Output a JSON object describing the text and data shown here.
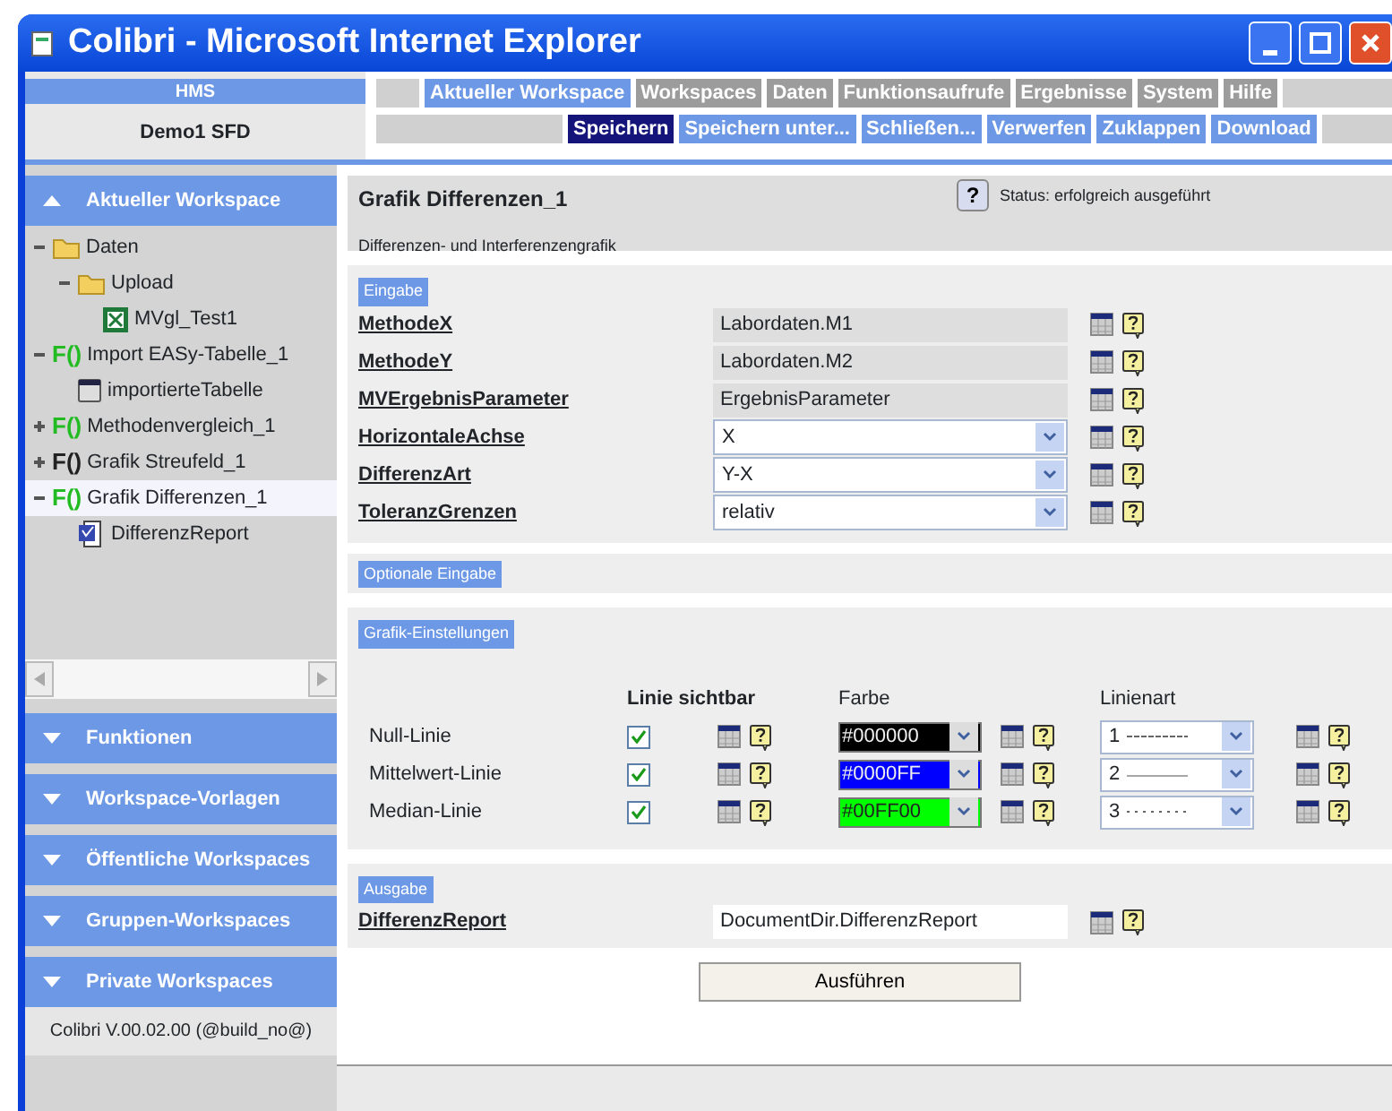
{
  "window": {
    "title": "Colibri - Microsoft Internet Explorer"
  },
  "header": {
    "app": "HMS",
    "workspace": "Demo1 SFD"
  },
  "menu": [
    {
      "label": "Aktueller Workspace",
      "selected": true
    },
    {
      "label": "Workspaces",
      "selected": false
    },
    {
      "label": "Daten",
      "selected": false
    },
    {
      "label": "Funktionsaufrufe",
      "selected": false
    },
    {
      "label": "Ergebnisse",
      "selected": false
    },
    {
      "label": "System",
      "selected": false
    },
    {
      "label": "Hilfe",
      "selected": false
    }
  ],
  "toolbar": [
    {
      "label": "Speichern",
      "selected": true
    },
    {
      "label": "Speichern unter...",
      "selected": false
    },
    {
      "label": "Schließen...",
      "selected": false
    },
    {
      "label": "Verwerfen",
      "selected": false
    },
    {
      "label": "Zuklappen",
      "selected": false
    },
    {
      "label": "Download",
      "selected": false
    }
  ],
  "sidebar": {
    "sections": [
      {
        "title": "Aktueller Workspace",
        "expanded": true,
        "tree": [
          {
            "label": "Daten",
            "kind": "folder",
            "expanded": true,
            "selected": false,
            "children": [
              {
                "label": "Upload",
                "kind": "folder",
                "expanded": true,
                "selected": false,
                "children": [
                  {
                    "label": "MVgl_Test1",
                    "kind": "excel",
                    "selected": false
                  }
                ]
              }
            ]
          },
          {
            "label": "Import EASy-Tabelle_1",
            "kind": "function",
            "badge": "F()",
            "color": "#22bb22",
            "expanded": true,
            "selected": false,
            "children": [
              {
                "label": "importierteTabelle",
                "kind": "table",
                "selected": false
              }
            ]
          },
          {
            "label": "Methodenvergleich_1",
            "kind": "function",
            "badge": "F()",
            "color": "#22bb22",
            "expanded": false,
            "selected": false
          },
          {
            "label": "Grafik Streufeld_1",
            "kind": "function",
            "badge": "F()",
            "color": "#222222",
            "expanded": false,
            "selected": false
          },
          {
            "label": "Grafik Differenzen_1",
            "kind": "function",
            "badge": "F()",
            "color": "#22bb22",
            "expanded": true,
            "selected": true,
            "children": [
              {
                "label": "DifferenzReport",
                "kind": "report",
                "selected": false
              }
            ]
          }
        ]
      },
      {
        "title": "Funktionen",
        "expanded": false
      },
      {
        "title": "Workspace-Vorlagen",
        "expanded": false
      },
      {
        "title": "Öffentliche Workspaces",
        "expanded": false
      },
      {
        "title": "Gruppen-Workspaces",
        "expanded": false
      },
      {
        "title": "Private Workspaces",
        "expanded": false
      }
    ],
    "version": "Colibri V.00.02.00 (@build_no@)"
  },
  "content": {
    "title": "Grafik Differenzen_1",
    "help_button": "?",
    "status": "Status: erfolgreich ausgeführt",
    "description": "Differenzen- und Interferenzengrafik",
    "input": {
      "title": "Eingabe",
      "fields": [
        {
          "label": "MethodeX",
          "kind": "readonly",
          "value": "Labordaten.M1"
        },
        {
          "label": "MethodeY",
          "kind": "readonly",
          "value": "Labordaten.M2"
        },
        {
          "label": "MVErgebnisParameter",
          "kind": "readonly",
          "value": "ErgebnisParameter"
        },
        {
          "label": "HorizontaleAchse",
          "kind": "select",
          "value": "X"
        },
        {
          "label": "DifferenzArt",
          "kind": "select",
          "value": "Y-X"
        },
        {
          "label": "ToleranzGrenzen",
          "kind": "select",
          "value": "relativ"
        }
      ]
    },
    "optional": {
      "title": "Optionale Eingabe"
    },
    "graphics": {
      "title": "Grafik-Einstellungen",
      "columns": [
        "Linie sichtbar",
        "Farbe",
        "Linienart"
      ],
      "lines": [
        {
          "label": "Null-Linie",
          "visible": true,
          "color_text": "#000000",
          "color": "#000000",
          "style_number": "1",
          "kind": "dashed"
        },
        {
          "label": "Mittelwert-Linie",
          "visible": true,
          "color_text": "#0000FF",
          "color": "#0000ff",
          "style_number": "2",
          "kind": "solid"
        },
        {
          "label": "Median-Linie",
          "visible": true,
          "color_text": "#00FF00",
          "color": "#00ff00",
          "style_number": "3",
          "kind": "dotted"
        }
      ]
    },
    "output": {
      "title": "Ausgabe",
      "fields": [
        {
          "label": "DifferenzReport",
          "kind": "text",
          "value": "DocumentDir.DifferenzReport"
        }
      ]
    },
    "run_button": "Ausführen"
  }
}
